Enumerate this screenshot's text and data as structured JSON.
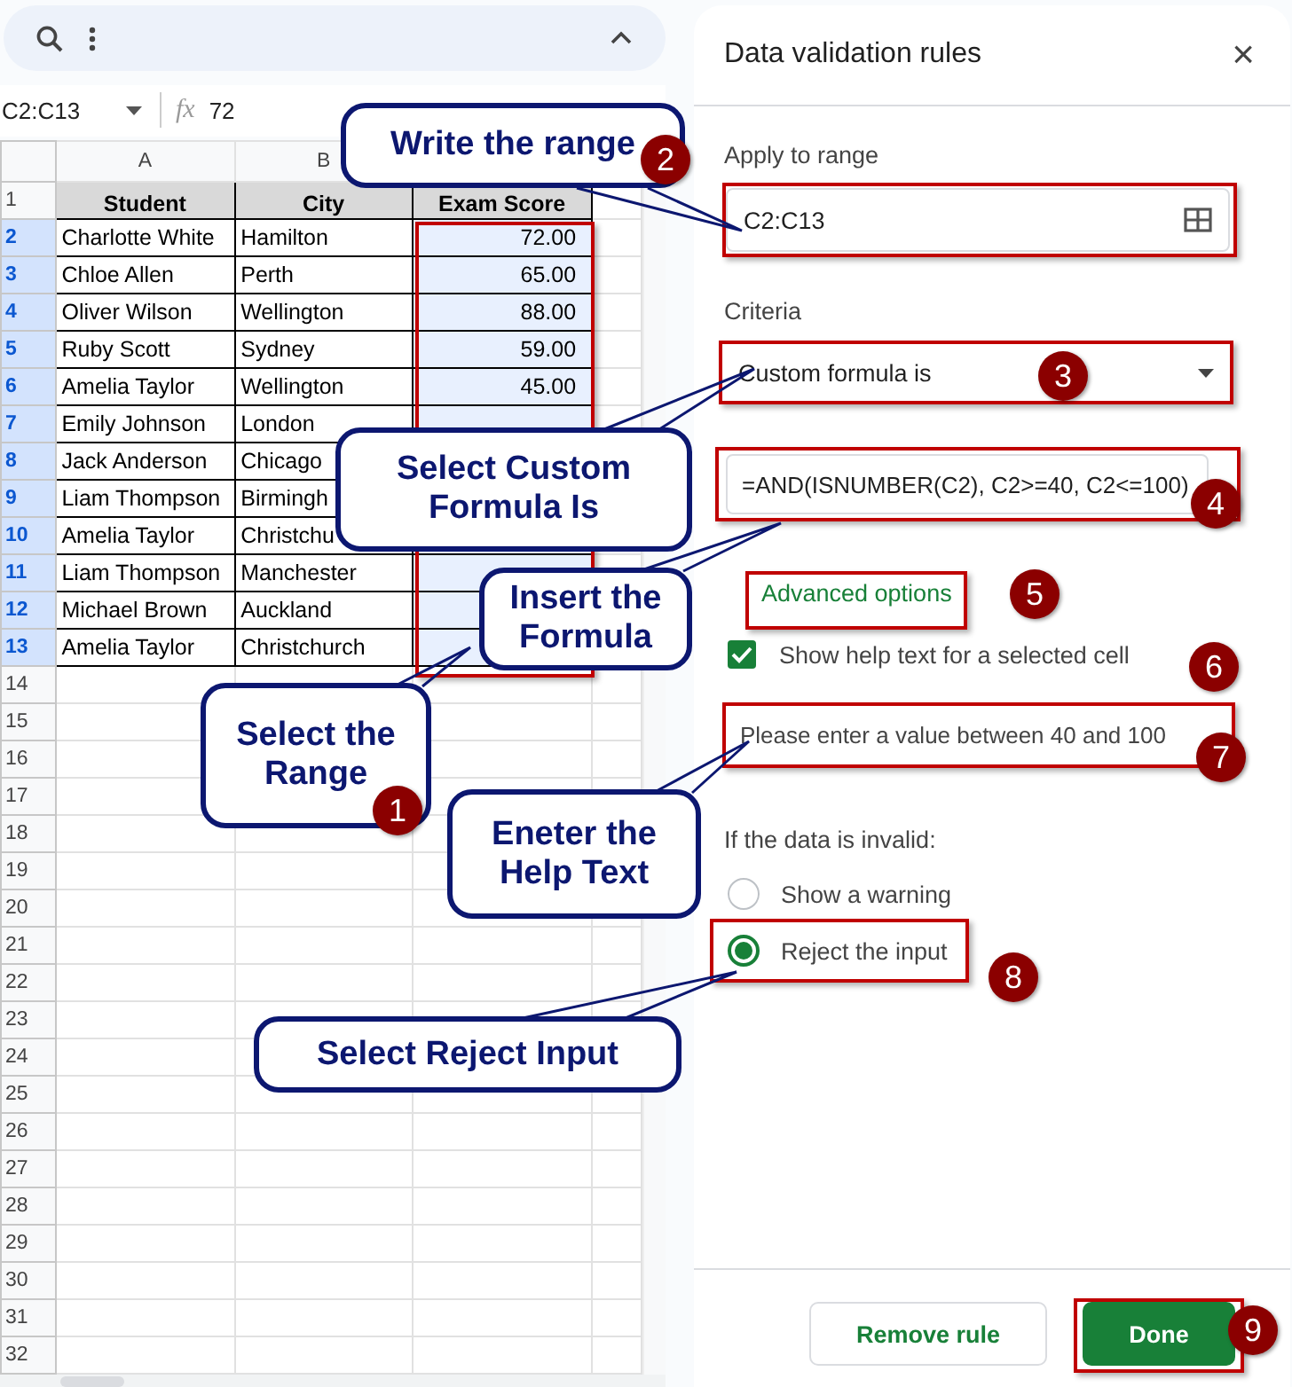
{
  "sheet": {
    "name_box": "C2:C13",
    "function_label": "fx",
    "formula_bar": "72",
    "columns": [
      "A",
      "B"
    ],
    "rows": [
      {
        "number": "1",
        "selected": false,
        "header": true,
        "cells": [
          "Student",
          "City",
          "Exam Score"
        ]
      },
      {
        "number": "2",
        "selected": true,
        "cells": [
          "Charlotte White",
          "Hamilton",
          "72.00"
        ]
      },
      {
        "number": "3",
        "selected": true,
        "cells": [
          "Chloe Allen",
          "Perth",
          "65.00"
        ]
      },
      {
        "number": "4",
        "selected": true,
        "cells": [
          "Oliver Wilson",
          "Wellington",
          "88.00"
        ]
      },
      {
        "number": "5",
        "selected": true,
        "cells": [
          "Ruby Scott",
          "Sydney",
          "59.00"
        ]
      },
      {
        "number": "6",
        "selected": true,
        "cells": [
          "Amelia Taylor",
          "Wellington",
          "45.00"
        ]
      },
      {
        "number": "7",
        "selected": true,
        "cells": [
          "Emily Johnson",
          "London"
        ]
      },
      {
        "number": "8",
        "selected": true,
        "cells": [
          "Jack Anderson",
          "Chicago"
        ]
      },
      {
        "number": "9",
        "selected": true,
        "cells": [
          "Liam Thompson",
          "Birmingh"
        ]
      },
      {
        "number": "10",
        "selected": true,
        "cells": [
          "Amelia Taylor",
          "Christchu"
        ]
      },
      {
        "number": "11",
        "selected": true,
        "cells": [
          "Liam Thompson",
          "Manchester"
        ]
      },
      {
        "number": "12",
        "selected": true,
        "cells": [
          "Michael Brown",
          "Auckland"
        ]
      },
      {
        "number": "13",
        "selected": true,
        "cells": [
          "Amelia Taylor",
          "Christchurch"
        ]
      }
    ],
    "empty_rows": [
      "14",
      "15",
      "16",
      "17",
      "18",
      "19",
      "20",
      "21",
      "22",
      "23",
      "24",
      "25",
      "26",
      "27",
      "28",
      "29",
      "30",
      "31",
      "32"
    ]
  },
  "panel": {
    "title": "Data validation rules",
    "close": "×",
    "range_label": "Apply to range",
    "range_value": "C2:C13",
    "criteria_label": "Criteria",
    "criteria_value": "Custom formula is",
    "formula_value": "=AND(ISNUMBER(C2), C2>=40, C2<=100)",
    "advanced_link": "Advanced options",
    "help_checkbox": {
      "label": "Show help text for a selected cell",
      "checked": true
    },
    "help_text": "Please enter a value between 40 and 100",
    "invalid_label": "If the data is invalid:",
    "options": [
      {
        "label": "Show a warning",
        "selected": false
      },
      {
        "label": "Reject the input",
        "selected": true
      }
    ],
    "buttons": [
      {
        "label": "Remove rule",
        "kind": "secondary"
      },
      {
        "label": "Done",
        "kind": "primary"
      }
    ]
  },
  "callouts": [
    {
      "text": "Write the range"
    },
    {
      "text": "Select Custom Formula Is"
    },
    {
      "text": "Insert the Formula"
    },
    {
      "text": "Select the Range"
    },
    {
      "text": "Eneter the Help Text"
    },
    {
      "text": "Select Reject Input"
    }
  ],
  "step_badges": [
    "1",
    "2",
    "3",
    "4",
    "5",
    "6",
    "7",
    "8",
    "9"
  ]
}
